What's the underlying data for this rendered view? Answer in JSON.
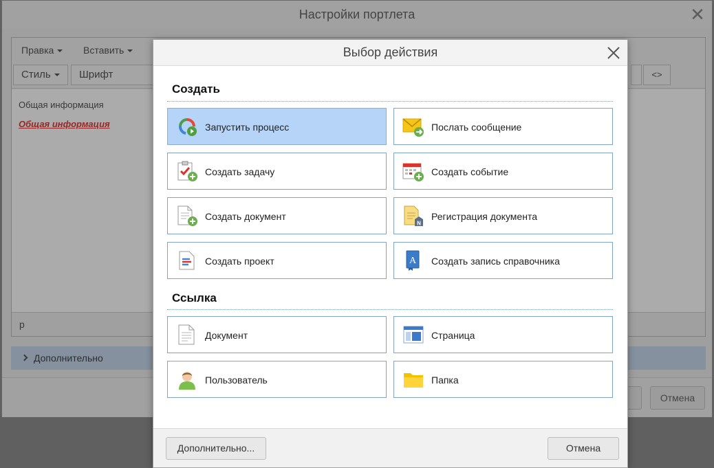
{
  "outer_window": {
    "title": "Настройки портлета",
    "menu": [
      "Правка",
      "Вставить"
    ],
    "toolbar": {
      "style": "Стиль",
      "font": "Шрифт",
      "code": "<>"
    },
    "content": {
      "text": "Общая информация",
      "link": "Общая информация"
    },
    "status_path": "p",
    "additional": "Дополнительно",
    "footer": {
      "ok_partial": "ь",
      "cancel": "Отмена"
    }
  },
  "modal": {
    "title": "Выбор действия",
    "sections": [
      {
        "title": "Создать",
        "items": [
          {
            "label": "Запустить процесс",
            "icon": "process-icon",
            "selected": true
          },
          {
            "label": "Послать сообщение",
            "icon": "message-icon"
          },
          {
            "label": "Создать задачу",
            "icon": "task-icon"
          },
          {
            "label": "Создать событие",
            "icon": "calendar-event-icon"
          },
          {
            "label": "Создать документ",
            "icon": "document-add-icon"
          },
          {
            "label": "Регистрация документа",
            "icon": "document-register-icon"
          },
          {
            "label": "Создать проект",
            "icon": "project-icon"
          },
          {
            "label": "Создать запись справочника",
            "icon": "directory-book-icon"
          }
        ]
      },
      {
        "title": "Ссылка",
        "items": [
          {
            "label": "Документ",
            "icon": "document-icon"
          },
          {
            "label": "Страница",
            "icon": "page-icon"
          },
          {
            "label": "Пользователь",
            "icon": "user-icon"
          },
          {
            "label": "Папка",
            "icon": "folder-icon"
          }
        ]
      }
    ],
    "footer": {
      "more": "Дополнительно...",
      "cancel": "Отмена"
    }
  },
  "colors": {
    "selected_tile": "#b6d4f7",
    "tile_border": "#7fa3c9",
    "link_red": "#e23b3b",
    "additional_bar": "#c7d8ec"
  }
}
